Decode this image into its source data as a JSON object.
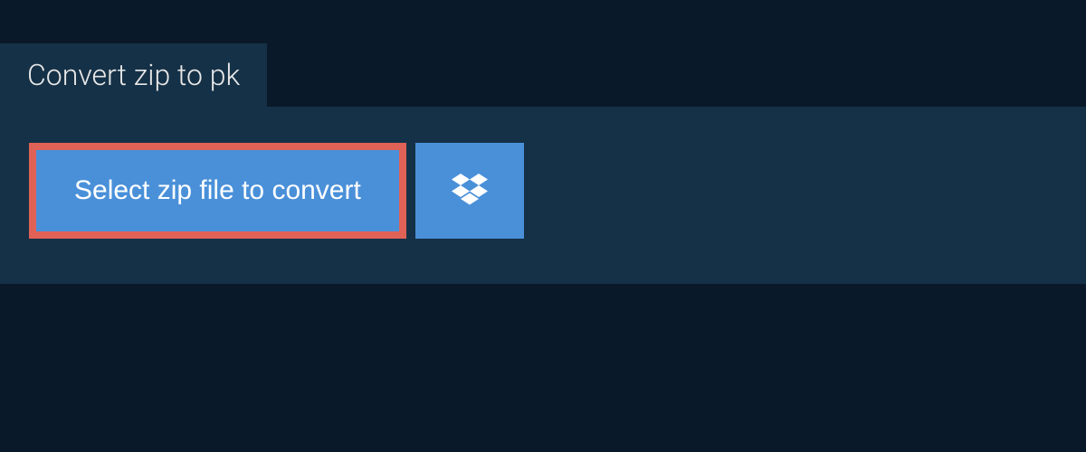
{
  "tab": {
    "title": "Convert zip to pk"
  },
  "actions": {
    "select_file_label": "Select zip file to convert"
  }
}
